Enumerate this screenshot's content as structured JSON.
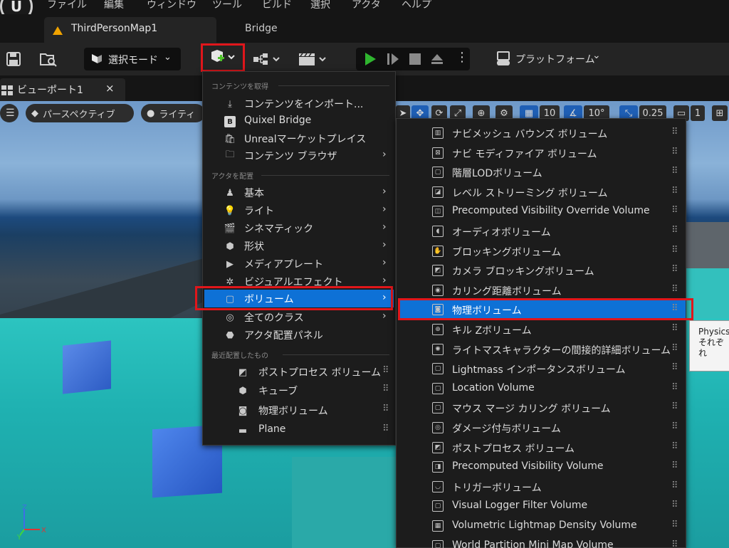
{
  "menubar": {
    "logo_text": "U",
    "items": [
      "ファイル",
      "編集",
      "ウィンドウ",
      "ツール",
      "ビルド",
      "選択",
      "アクタ",
      "ヘルプ"
    ]
  },
  "tabs": {
    "map": "ThirdPersonMap1",
    "bridge": "Bridge"
  },
  "toolbar": {
    "mode": "選択モード",
    "platform": "プラットフォーム"
  },
  "viewport_tab": {
    "label": "ビューポート1",
    "close": "×"
  },
  "viewport_toolbar": {
    "perspective": "パースペクティブ",
    "lighting": "ライティ",
    "grid_snap": "10",
    "rotation_snap": "10°",
    "scale_snap": "0.25",
    "camera_speed": "1"
  },
  "add_menu": {
    "sections": {
      "get_content": "コンテンツを取得",
      "place_actors": "アクタを配置",
      "recent": "最近配置したもの"
    },
    "get_content_items": [
      {
        "label": "コンテンツをインポート...",
        "icon": "import-icon"
      },
      {
        "label": "Quixel Bridge",
        "icon": "bridge-icon"
      },
      {
        "label": "Unrealマーケットプレイス",
        "icon": "marketplace-icon"
      },
      {
        "label": "コンテンツ ブラウザ",
        "icon": "content-browser-icon",
        "submenu": true
      }
    ],
    "place_items": [
      {
        "label": "基本",
        "icon": "basic-icon",
        "submenu": true
      },
      {
        "label": "ライト",
        "icon": "light-icon",
        "submenu": true
      },
      {
        "label": "シネマティック",
        "icon": "cinematic-icon",
        "submenu": true
      },
      {
        "label": "形状",
        "icon": "shape-icon",
        "submenu": true
      },
      {
        "label": "メディアプレート",
        "icon": "media-plate-icon",
        "submenu": true
      },
      {
        "label": "ビジュアルエフェクト",
        "icon": "visual-effects-icon",
        "submenu": true
      },
      {
        "label": "ボリューム",
        "icon": "volume-icon",
        "submenu": true,
        "active": true
      },
      {
        "label": "全てのクラス",
        "icon": "all-classes-icon",
        "submenu": true
      },
      {
        "label": "アクタ配置パネル",
        "icon": "place-actors-panel-icon"
      }
    ],
    "recent_items": [
      {
        "label": "ポストプロセス ボリューム",
        "icon": "post-process-icon"
      },
      {
        "label": "キューブ",
        "icon": "cube-icon"
      },
      {
        "label": "物理ボリューム",
        "icon": "physics-volume-icon"
      },
      {
        "label": "Plane",
        "icon": "plane-icon"
      }
    ]
  },
  "volume_menu": {
    "items": [
      "ナビメッシュ バウンズ ボリューム",
      "ナビ モディファイア ボリューム",
      "階層LODボリューム",
      "レベル ストリーミング ボリューム",
      "Precomputed Visibility Override Volume",
      "オーディオボリューム",
      "ブロッキングボリューム",
      "カメラ ブロッキングボリューム",
      "カリング距離ボリューム",
      "物理ボリューム",
      "キル Zボリューム",
      "ライトマスキャラクターの間接的詳細ボリューム",
      "Lightmass インポータンスボリューム",
      "Location Volume",
      "マウス マージ カリング ボリューム",
      "ダメージ付与ボリューム",
      "ポストプロセス ボリューム",
      "Precomputed Visibility Volume",
      "トリガーボリューム",
      "Visual Logger Filter Volume",
      "Volumetric Lightmap Density Volume",
      "World Partition Mini Map Volume"
    ],
    "active_index": 9
  },
  "tooltip": {
    "line1": "Physics",
    "line2": "それぞれ"
  },
  "colors": {
    "highlight_red": "#e0161b",
    "selection_blue": "#0e71d6",
    "play_green": "#2fb52f",
    "add_plus_green": "#4fc22a"
  }
}
